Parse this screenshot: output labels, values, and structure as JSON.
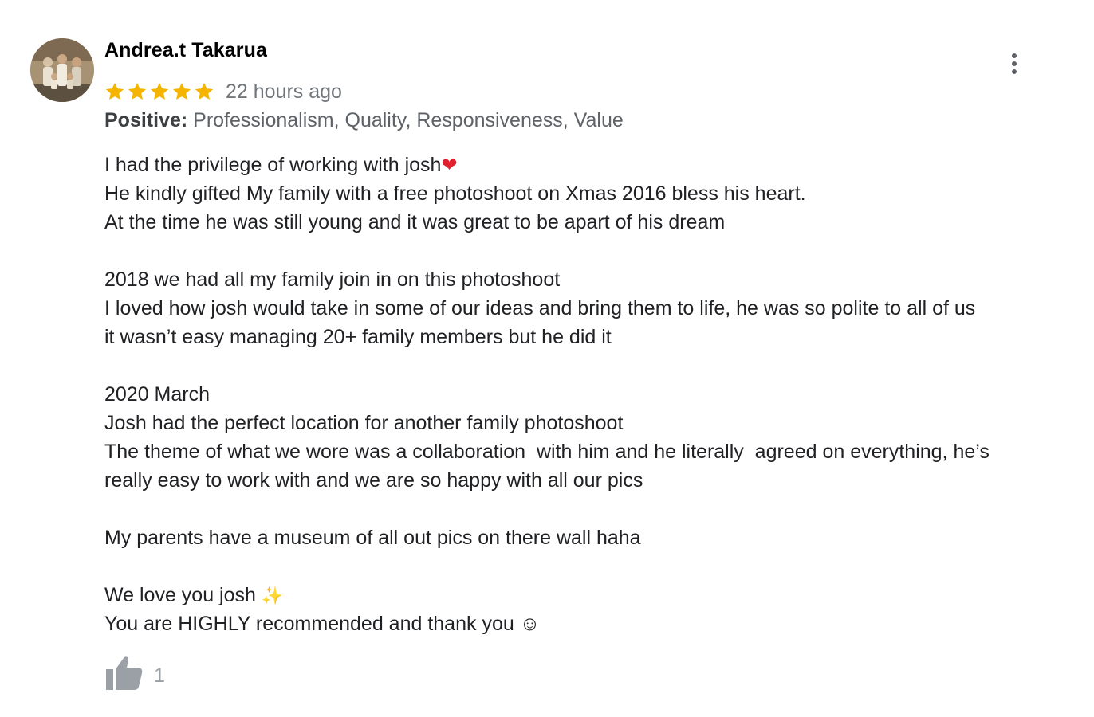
{
  "review": {
    "author": "Andrea.t Takarua",
    "rating": 5,
    "rating_max": 5,
    "time": "22 hours ago",
    "attributes_label": "Positive:",
    "attributes_values": " Professionalism, Quality, Responsiveness, Value",
    "lines": [
      "I had the privilege of working with josh",
      "He kindly gifted My family with a free photoshoot on Xmas 2016 bless his heart.",
      "At the time he was still young and it was great to be apart of his dream",
      "",
      "2018 we had all my family join in on this photoshoot",
      "I loved how josh would take in some of our ideas and bring them to life, he was so polite to all of us",
      "it wasn’t easy managing 20+ family members but he did it",
      "",
      "2020 March",
      "Josh had the perfect location for another family photoshoot",
      "The theme of what we wore was a collaboration  with him and he literally  agreed on everything, he’s",
      "really easy to work with and we are so happy with all our pics",
      "",
      "My parents have a museum of all out pics on there wall haha",
      "",
      "We love you josh ",
      "You are HIGHLY recommended and thank you ☺"
    ],
    "heart_emoji": "❤",
    "sparkle_emoji": "✨",
    "like_count": "1"
  },
  "icons": {
    "avatar": "avatar-photo",
    "star": "star-icon",
    "more": "more-vert-icon",
    "like": "thumb-up-icon"
  },
  "colors": {
    "star": "#f4b400",
    "text": "#202124",
    "muted": "#70757a",
    "icon": "#5f6368",
    "like_icon": "#9aa0a6"
  }
}
